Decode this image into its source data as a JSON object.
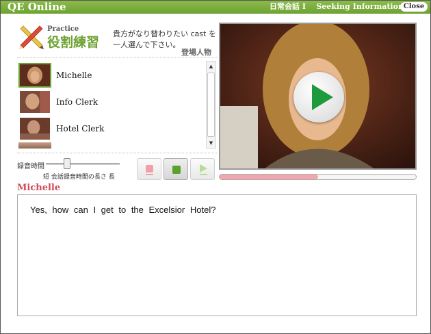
{
  "window": {
    "app_title": "QE Online",
    "lesson_title": "日常会話 I",
    "lesson_subtitle": "Seeking Information",
    "close_label": "Close"
  },
  "header": {
    "practice_en": "Practice",
    "practice_jp": "役割練習",
    "instruction": "貴方がなり替わりたい cast を一人選んで下さい。",
    "cast_heading": "登場人物",
    "icon": "pencil-ruler-icon"
  },
  "cast": {
    "items": [
      {
        "name": "Michelle",
        "selected": true,
        "thumb_color": "#a87a5e"
      },
      {
        "name": "Info Clerk",
        "selected": false,
        "thumb_color": "#b07d68"
      },
      {
        "name": "Hotel Clerk",
        "selected": false,
        "thumb_color": "#9c6e5a"
      }
    ],
    "scroll_up_icon": "triangle-up-icon",
    "scroll_down_icon": "triangle-down-icon"
  },
  "recording": {
    "label": "録音時間",
    "caption": "短  会話録音時間の長さ  長",
    "slider_level": 0.25,
    "buttons": [
      {
        "icon": "record-stop-icon",
        "color": "#f0a0a8",
        "active": false
      },
      {
        "icon": "stop-icon",
        "color": "#5aa22a",
        "active": true
      },
      {
        "icon": "play-icon",
        "color": "#b8dc94",
        "active": false
      }
    ]
  },
  "video": {
    "play_icon": "play-icon",
    "accent": "#1e9a3c",
    "progress": 0.5
  },
  "transcript": {
    "speaker": "Michelle",
    "line": "Yes, how can I get to the Excelsior Hotel?"
  }
}
